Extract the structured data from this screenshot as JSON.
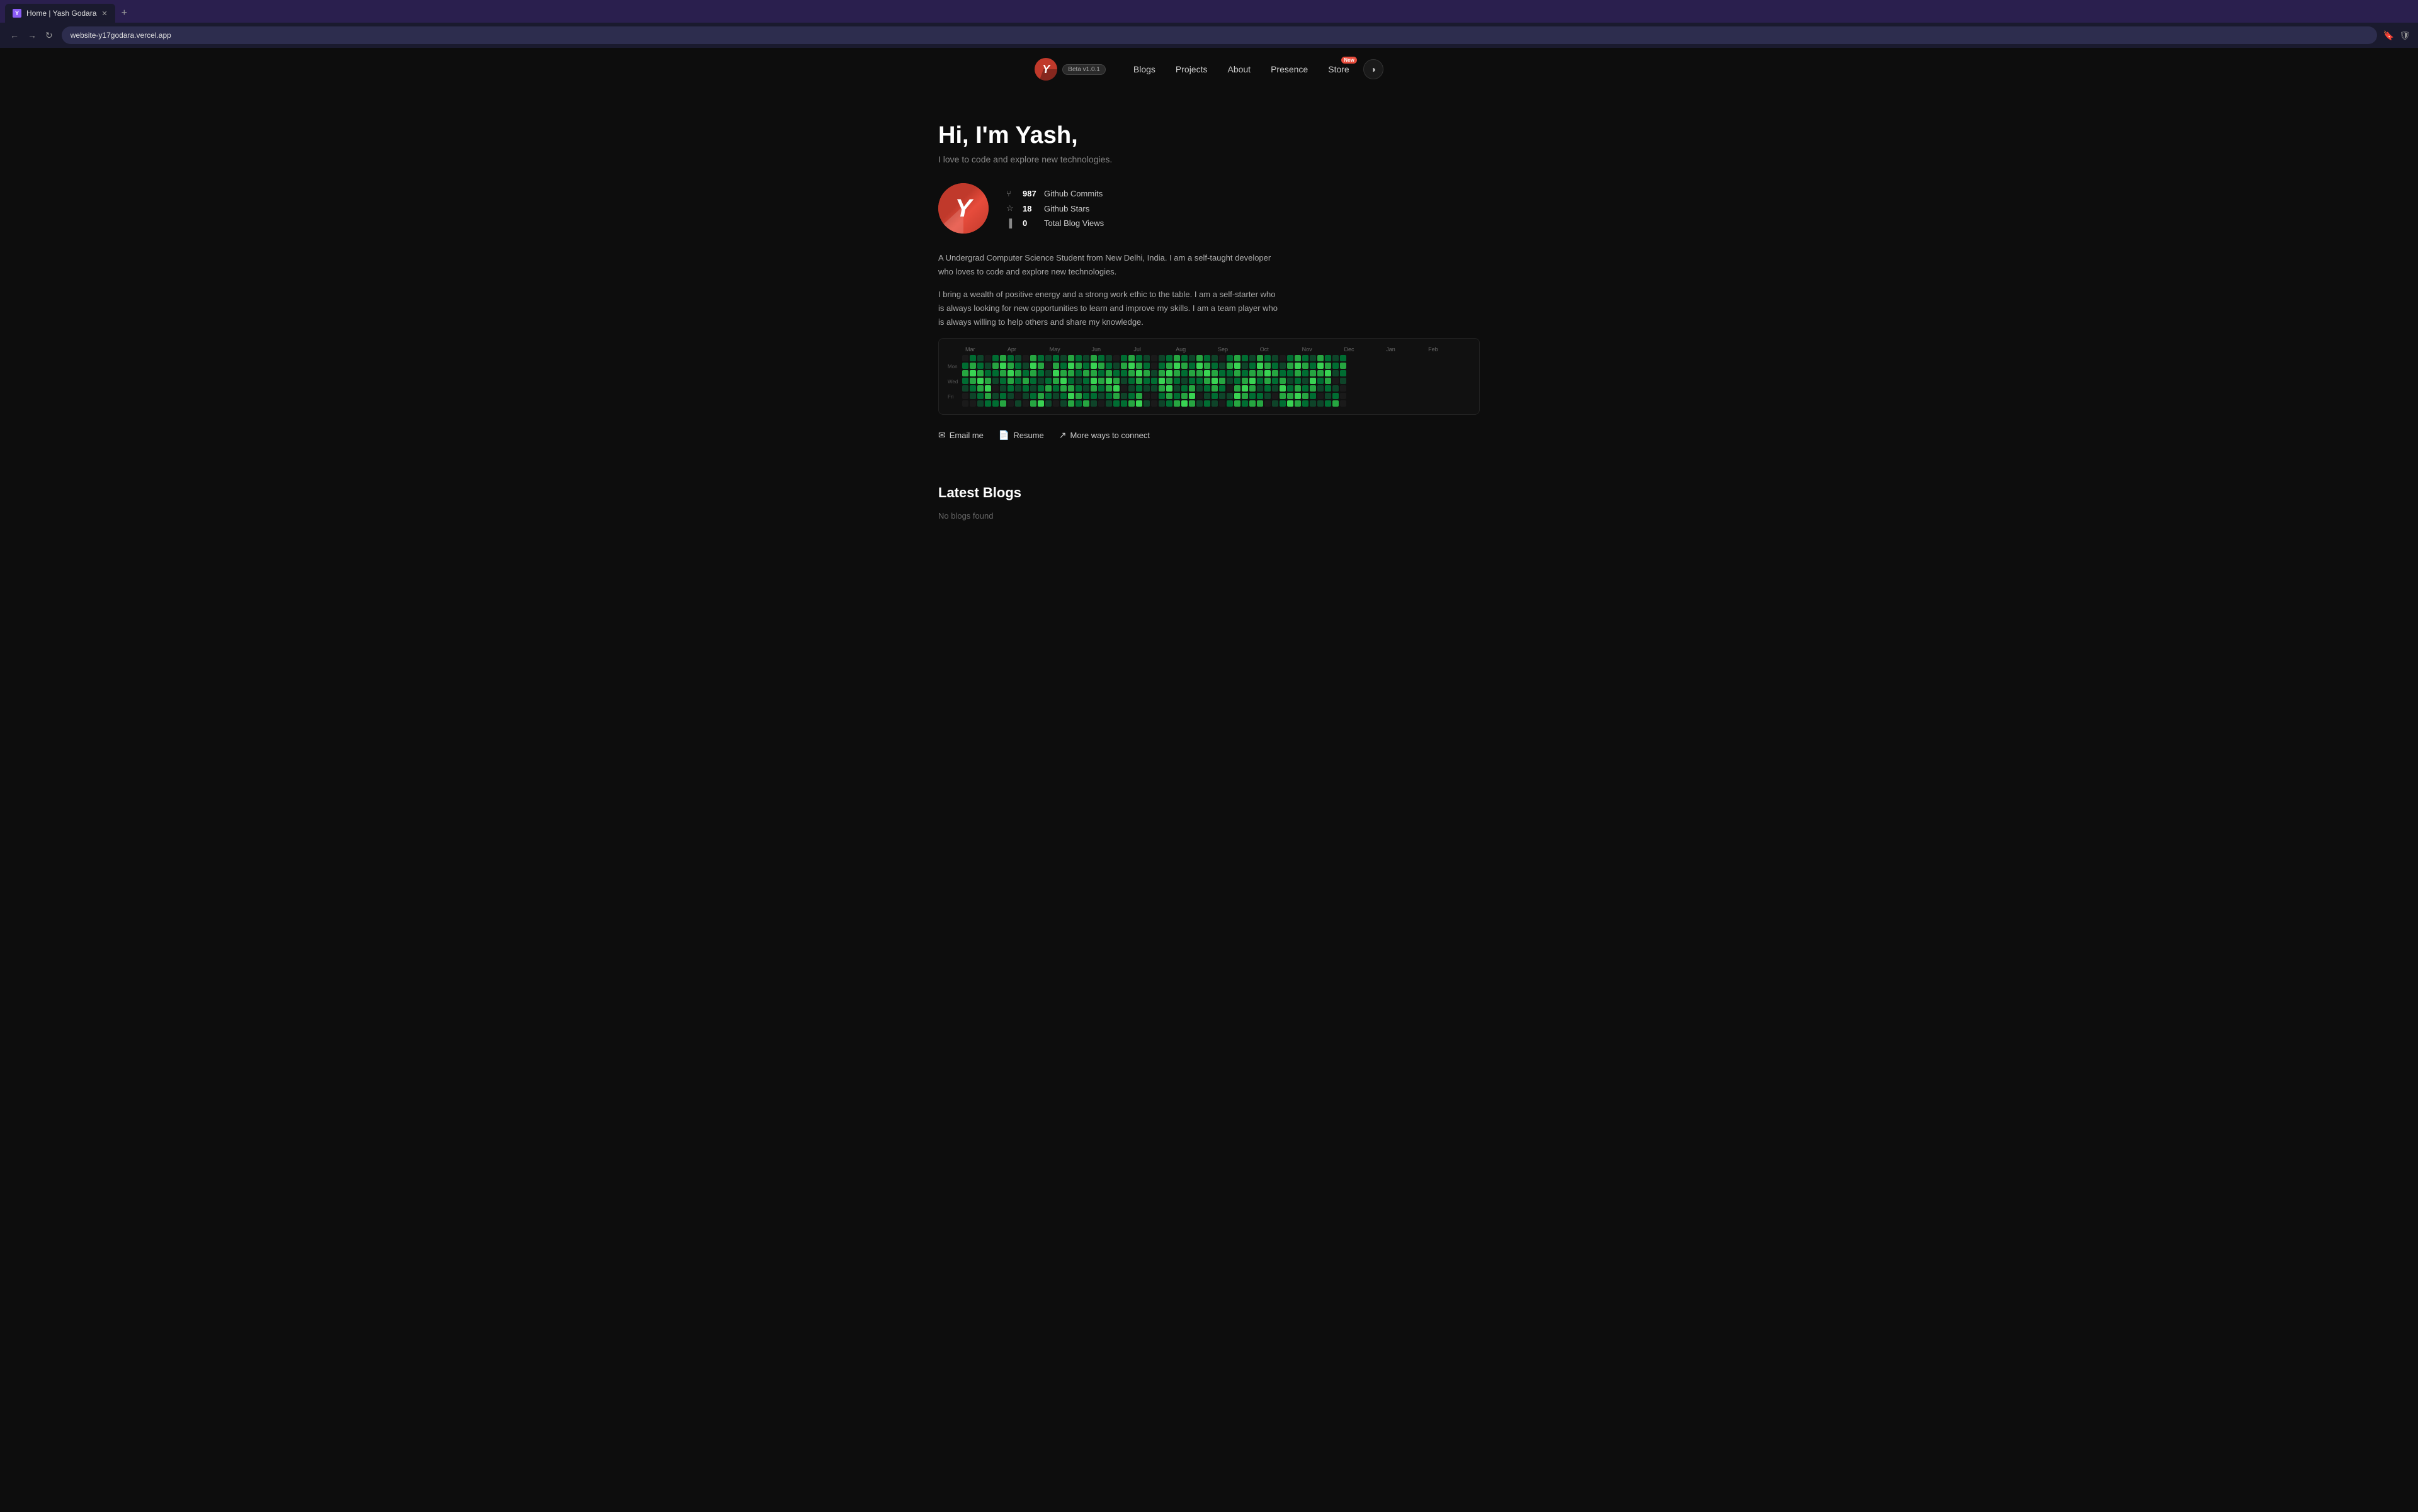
{
  "browser": {
    "tab_title": "Home | Yash Godara",
    "url": "website-y17godara.vercel.app",
    "new_tab_label": "+",
    "back_icon": "←",
    "forward_icon": "→",
    "reload_icon": "↻",
    "bookmark_icon": "🔖"
  },
  "nav": {
    "logo_letter": "Y",
    "beta_label": "Beta v1.0.1",
    "links": [
      {
        "label": "Blogs",
        "id": "blogs"
      },
      {
        "label": "Projects",
        "id": "projects"
      },
      {
        "label": "About",
        "id": "about"
      },
      {
        "label": "Presence",
        "id": "presence"
      },
      {
        "label": "Store",
        "id": "store",
        "badge": "New"
      }
    ],
    "theme_icon": "◑"
  },
  "hero": {
    "greeting": "Hi, I'm Yash,",
    "tagline": "I love to code and explore new technologies.",
    "avatar_letter": "Y",
    "stats": [
      {
        "icon": "⑂",
        "value": "987",
        "label": "Github Commits"
      },
      {
        "icon": "☆",
        "value": "18",
        "label": "Github Stars"
      },
      {
        "icon": "▐",
        "value": "0",
        "label": "Total Blog Views"
      }
    ],
    "bio1": "A Undergrad Computer Science Student from New Delhi, India. I am a self-taught developer who loves to code and explore new technologies.",
    "bio2": "I bring a wealth of positive energy and a strong work ethic to the table. I am a self-starter who is always looking for new opportunities to learn and improve my skills. I am a team player who is always willing to help others and share my knowledge.",
    "action_links": [
      {
        "icon": "✉",
        "label": "Email me",
        "id": "email"
      },
      {
        "icon": "📄",
        "label": "Resume",
        "id": "resume"
      },
      {
        "icon": "↗",
        "label": "More ways to connect",
        "id": "connect"
      }
    ]
  },
  "contrib_graph": {
    "months": [
      "Mar",
      "Apr",
      "May",
      "Jun",
      "Jul",
      "Aug",
      "Sep",
      "Oct",
      "Nov",
      "Dec",
      "Jan",
      "Feb"
    ],
    "day_labels": [
      "Mon",
      "",
      "Wed",
      "",
      "Fri"
    ],
    "weeks": 52
  },
  "latest_blogs": {
    "title": "Latest Blogs",
    "empty_message": "No blogs found"
  }
}
